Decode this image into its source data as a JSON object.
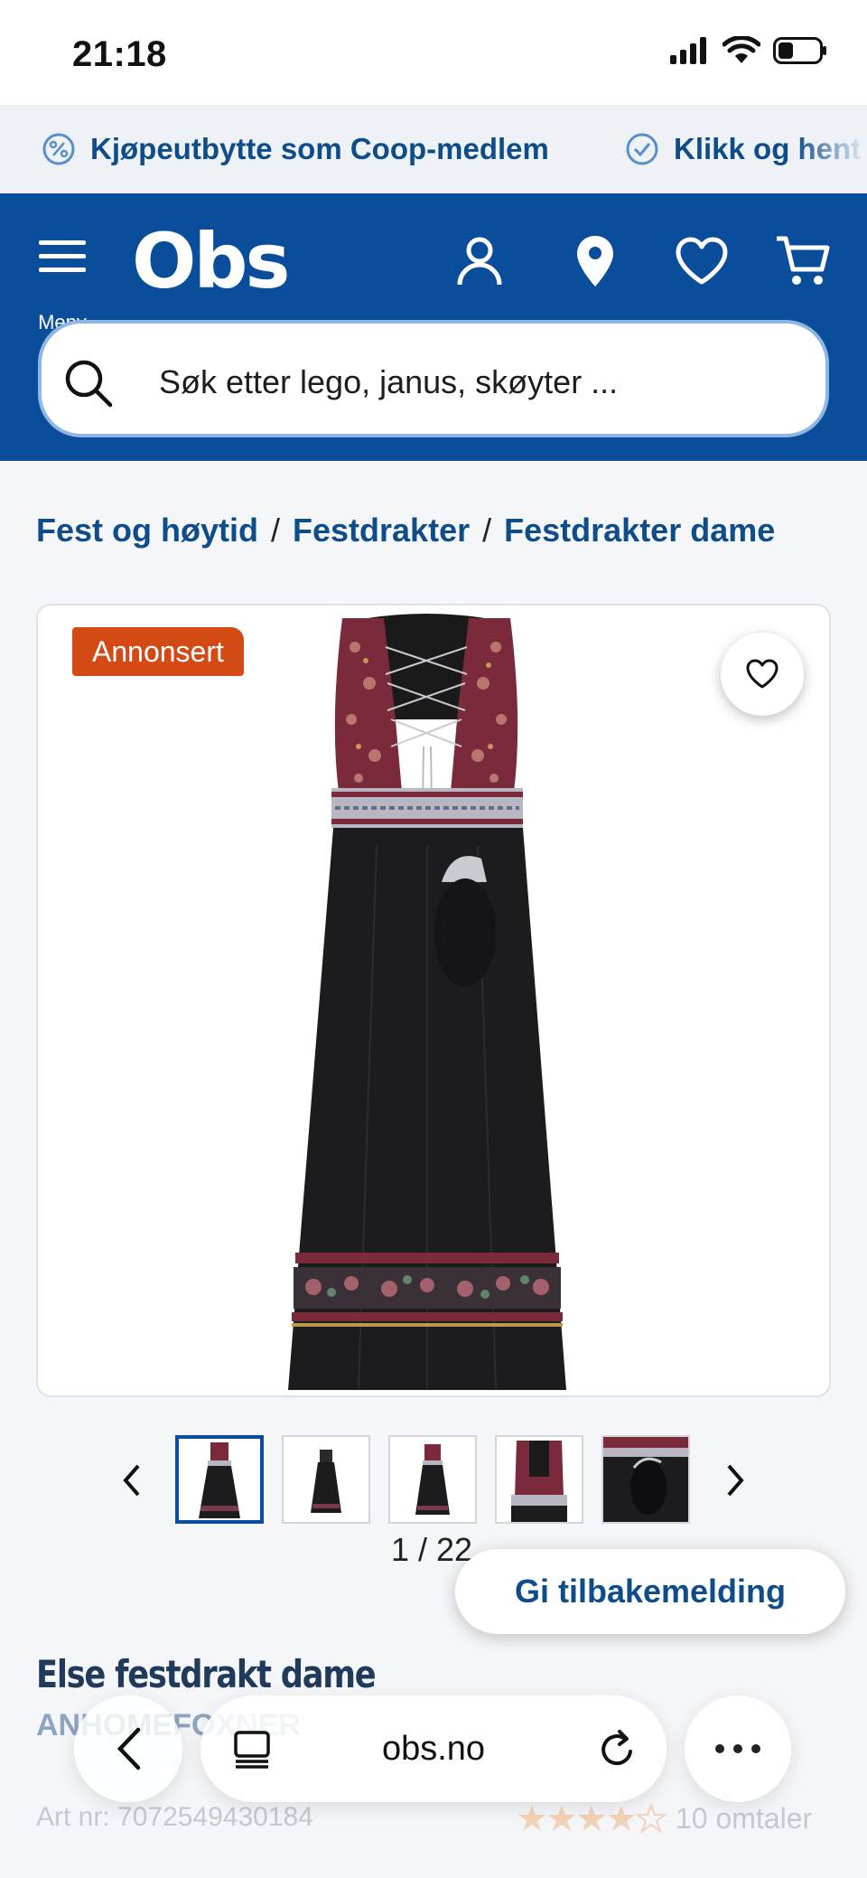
{
  "status_bar": {
    "time": "21:18"
  },
  "promo": {
    "items": [
      {
        "label": "Kjøpeutbytte som Coop-medlem",
        "icon": "percent-badge-icon"
      },
      {
        "label": "Klikk og hent",
        "icon": "check-circle-icon"
      }
    ]
  },
  "header": {
    "menu_label": "Meny",
    "logo": "Obs",
    "icons": [
      "account-icon",
      "location-pin-icon",
      "heart-icon",
      "cart-icon"
    ],
    "search_placeholder": "Søk etter lego, janus, skøyter ..."
  },
  "breadcrumb": [
    "Fest og høytid",
    "Festdrakter",
    "Festdrakter dame"
  ],
  "gallery": {
    "badge": "Annonsert",
    "counter": "1 / 22",
    "active_index": 1,
    "total": 22
  },
  "feedback_button": "Gi tilbakemelding",
  "product": {
    "title": "Else festdrakt dame",
    "brand": "ANHOMEFOXNER",
    "art_nr": "Art nr: 7072549430184",
    "rating": 4.5,
    "reviews": "10 omtaler"
  },
  "browser": {
    "url": "obs.no"
  },
  "colors": {
    "brand_blue": "#0a4e9b",
    "badge_orange": "#d44a14",
    "link_blue": "#0f4d8a"
  }
}
